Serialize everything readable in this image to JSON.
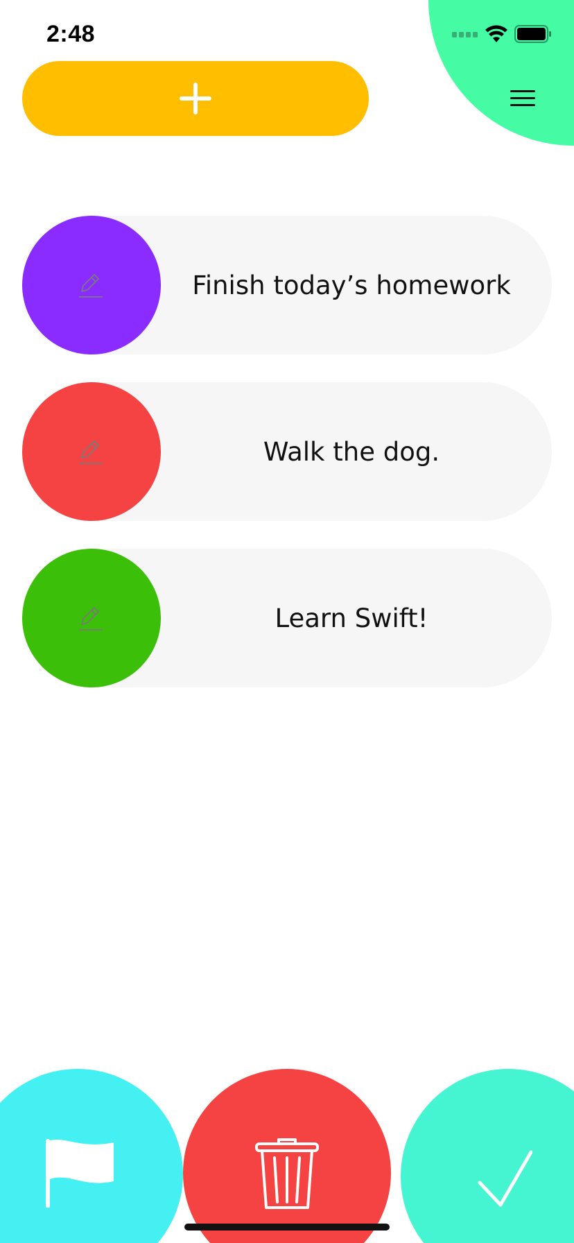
{
  "status_bar": {
    "time": "2:48"
  },
  "header": {
    "add_icon": "plus-icon",
    "menu_icon": "hamburger-menu-icon"
  },
  "tasks": [
    {
      "title": "Finish today’s homework",
      "color": "#8a2bff",
      "icon": "pencil-icon"
    },
    {
      "title": "Walk the dog.",
      "color": "#f54242",
      "icon": "pencil-icon"
    },
    {
      "title": "Learn Swift!",
      "color": "#3cbf08",
      "icon": "pencil-icon"
    }
  ],
  "bottom_actions": [
    {
      "name": "flag",
      "icon": "flag-icon",
      "color": "#44f0f2"
    },
    {
      "name": "delete",
      "icon": "trash-icon",
      "color": "#f54242"
    },
    {
      "name": "complete",
      "icon": "checkmark-icon",
      "color": "#45f5d2"
    }
  ],
  "colors": {
    "accent": "#ffbe00",
    "menu_blob": "#45fba3",
    "row_bg": "#f6f6f6"
  }
}
